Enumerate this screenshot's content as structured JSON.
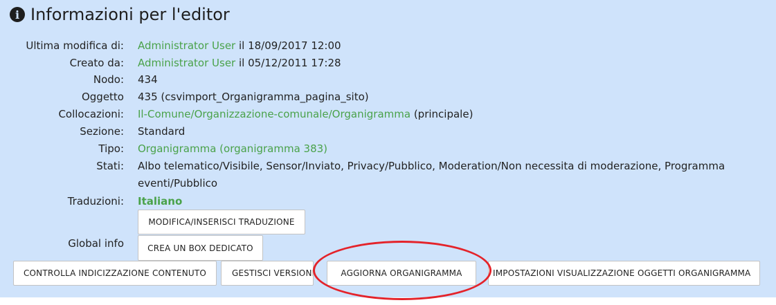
{
  "title": "Informazioni per l'editor",
  "icons": {
    "info": "info-circle-icon"
  },
  "fields": {
    "ultima_modifica": {
      "label": "Ultima modifica di:",
      "user": "Administrator User",
      "date": " il 18/09/2017 12:00"
    },
    "creato_da": {
      "label": "Creato da:",
      "user": "Administrator User",
      "date": " il 05/12/2011 17:28"
    },
    "nodo": {
      "label": "Nodo:",
      "value": "434"
    },
    "oggetto": {
      "label": "Oggetto",
      "value": "435 (csvimport_Organigramma_pagina_sito)"
    },
    "collocazioni": {
      "label": "Collocazioni:",
      "link": "Il-Comune/Organizzazione-comunale/Organigramma",
      "suffix": " (principale)"
    },
    "sezione": {
      "label": "Sezione:",
      "value": "Standard"
    },
    "tipo": {
      "label": "Tipo:",
      "link": "Organigramma (organigramma 383)"
    },
    "stati": {
      "label": "Stati:",
      "value": "Albo telematico/Visibile, Sensor/Inviato, Privacy/Pubblico, Moderation/Non necessita di moderazione, Programma eventi/Pubblico"
    },
    "traduzioni": {
      "label": "Traduzioni:",
      "link": "Italiano"
    },
    "global_info": {
      "label": "Global info"
    }
  },
  "buttons": {
    "modifica_traduzione": "MODIFICA/INSERISCI TRADUZIONE",
    "crea_box": "CREA UN BOX DEDICATO",
    "controlla_indicizzazione": "CONTROLLA INDICIZZAZIONE CONTENUTO",
    "gestisci_versioni": "GESTISCI VERSIONI",
    "aggiorna_organigramma": "AGGIORNA ORGANIGRAMMA",
    "impostazioni_visualizzazione": "IMPOSTAZIONI VISUALIZZAZIONE OGGETTI ORGANIGRAMMA"
  },
  "colors": {
    "panel_bg": "#cfe3fb",
    "link": "#4aa24a",
    "highlight_circle": "#e4232a"
  }
}
